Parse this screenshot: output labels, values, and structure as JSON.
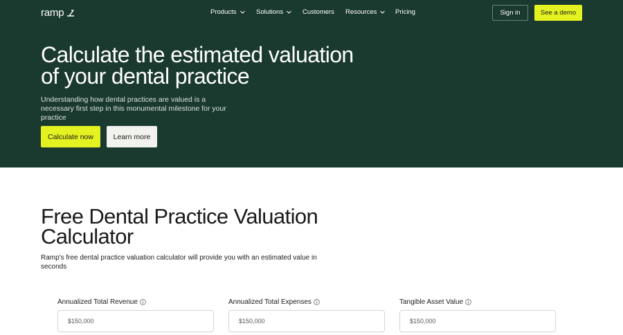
{
  "brand": {
    "name": "ramp",
    "accent": "#e4f222",
    "hero_bg": "#1b3a2f"
  },
  "nav": {
    "items": [
      {
        "label": "Products",
        "has_dropdown": true
      },
      {
        "label": "Solutions",
        "has_dropdown": true
      },
      {
        "label": "Customers",
        "has_dropdown": false
      },
      {
        "label": "Resources",
        "has_dropdown": true
      },
      {
        "label": "Pricing",
        "has_dropdown": false
      }
    ],
    "sign_in": "Sign in",
    "demo": "See a demo"
  },
  "hero": {
    "title": "Calculate the estimated valuation of your dental practice",
    "subtitle": "Understanding how dental practices are valued is a necessary first step in this monumental milestone for your practice",
    "primary_cta": "Calculate now",
    "secondary_cta": "Learn more"
  },
  "calculator": {
    "title": "Free Dental Practice Valuation Calculator",
    "description": "Ramp's free dental practice valuation calculator will provide you with an estimated value in seconds",
    "fields": [
      {
        "label": "Annualized Total Revenue",
        "placeholder": "$150,000",
        "icon": "info-icon"
      },
      {
        "label": "Annualized Total Expenses",
        "placeholder": "$150,000",
        "icon": "info-icon"
      },
      {
        "label": "Tangible Asset Value",
        "placeholder": "$150,000",
        "icon": "info-icon"
      }
    ]
  }
}
